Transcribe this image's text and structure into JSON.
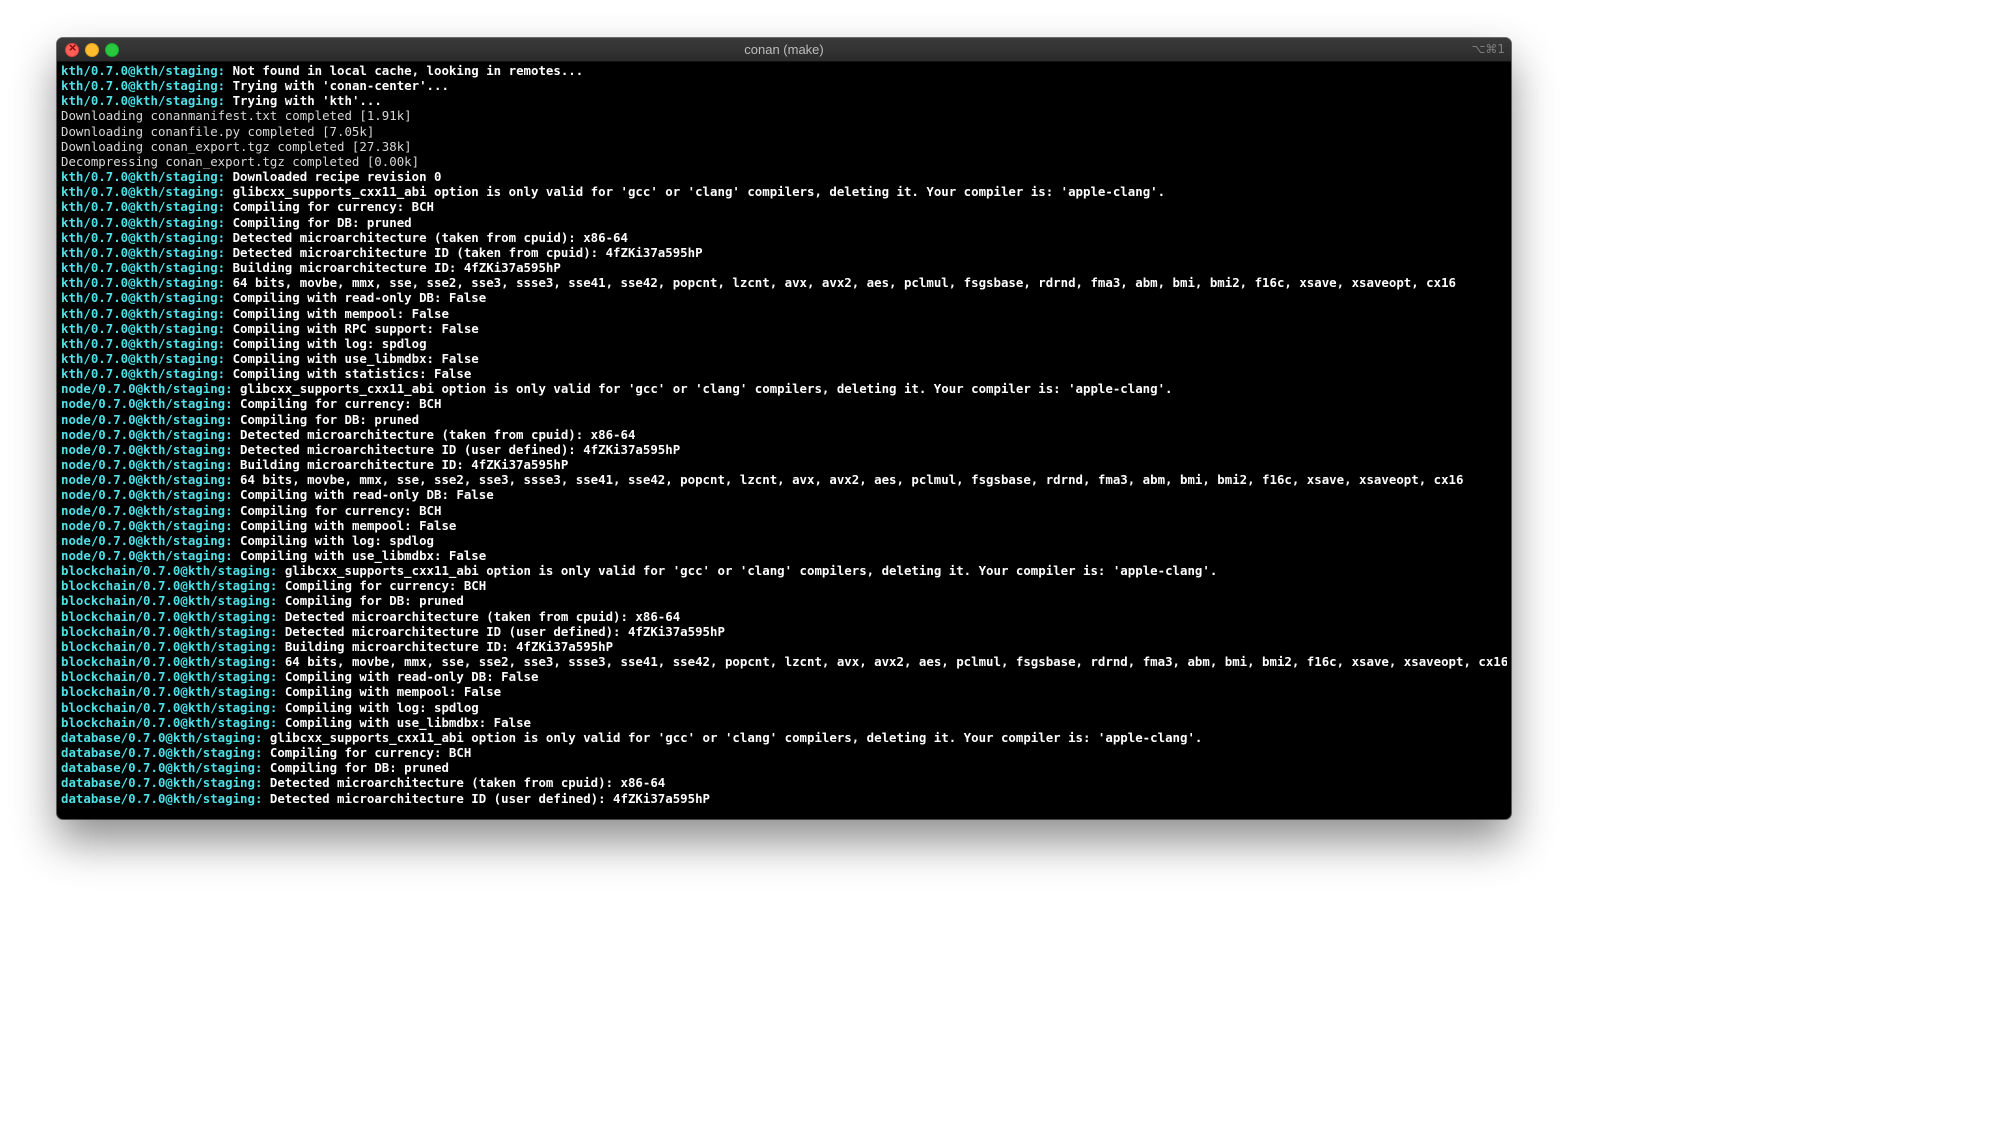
{
  "window": {
    "title": "conan (make)",
    "shortcut": "⌥⌘1"
  },
  "colors": {
    "prefix": "#4fe0e7",
    "text": "#ffffff",
    "background": "#000000"
  },
  "icons": [
    "close-icon",
    "minimize-icon",
    "zoom-icon"
  ],
  "lines": [
    {
      "prefix": "kth/0.7.0@kth/staging:",
      "text": "Not found in local cache, looking in remotes..."
    },
    {
      "prefix": "kth/0.7.0@kth/staging:",
      "text": "Trying with 'conan-center'..."
    },
    {
      "prefix": "kth/0.7.0@kth/staging:",
      "text": "Trying with 'kth'..."
    },
    {
      "prefix": "",
      "text": "Downloading conanmanifest.txt completed [1.91k]"
    },
    {
      "prefix": "",
      "text": "Downloading conanfile.py completed [7.05k]"
    },
    {
      "prefix": "",
      "text": "Downloading conan_export.tgz completed [27.38k]"
    },
    {
      "prefix": "",
      "text": "Decompressing conan_export.tgz completed [0.00k]"
    },
    {
      "prefix": "kth/0.7.0@kth/staging:",
      "text": "Downloaded recipe revision 0"
    },
    {
      "prefix": "kth/0.7.0@kth/staging:",
      "text": "glibcxx_supports_cxx11_abi option is only valid for 'gcc' or 'clang' compilers, deleting it. Your compiler is: 'apple-clang'."
    },
    {
      "prefix": "kth/0.7.0@kth/staging:",
      "text": "Compiling for currency: BCH"
    },
    {
      "prefix": "kth/0.7.0@kth/staging:",
      "text": "Compiling for DB: pruned"
    },
    {
      "prefix": "kth/0.7.0@kth/staging:",
      "text": "Detected microarchitecture (taken from cpuid): x86-64"
    },
    {
      "prefix": "kth/0.7.0@kth/staging:",
      "text": "Detected microarchitecture ID (taken from cpuid): 4fZKi37a595hP"
    },
    {
      "prefix": "kth/0.7.0@kth/staging:",
      "text": "Building microarchitecture ID: 4fZKi37a595hP"
    },
    {
      "prefix": "kth/0.7.0@kth/staging:",
      "text": "64 bits, movbe, mmx, sse, sse2, sse3, ssse3, sse41, sse42, popcnt, lzcnt, avx, avx2, aes, pclmul, fsgsbase, rdrnd, fma3, abm, bmi, bmi2, f16c, xsave, xsaveopt, cx16"
    },
    {
      "prefix": "kth/0.7.0@kth/staging:",
      "text": "Compiling with read-only DB: False"
    },
    {
      "prefix": "kth/0.7.0@kth/staging:",
      "text": "Compiling with mempool: False"
    },
    {
      "prefix": "kth/0.7.0@kth/staging:",
      "text": "Compiling with RPC support: False"
    },
    {
      "prefix": "kth/0.7.0@kth/staging:",
      "text": "Compiling with log: spdlog"
    },
    {
      "prefix": "kth/0.7.0@kth/staging:",
      "text": "Compiling with use_libmdbx: False"
    },
    {
      "prefix": "kth/0.7.0@kth/staging:",
      "text": "Compiling with statistics: False"
    },
    {
      "prefix": "node/0.7.0@kth/staging:",
      "text": "glibcxx_supports_cxx11_abi option is only valid for 'gcc' or 'clang' compilers, deleting it. Your compiler is: 'apple-clang'."
    },
    {
      "prefix": "node/0.7.0@kth/staging:",
      "text": "Compiling for currency: BCH"
    },
    {
      "prefix": "node/0.7.0@kth/staging:",
      "text": "Compiling for DB: pruned"
    },
    {
      "prefix": "node/0.7.0@kth/staging:",
      "text": "Detected microarchitecture (taken from cpuid): x86-64"
    },
    {
      "prefix": "node/0.7.0@kth/staging:",
      "text": "Detected microarchitecture ID (user defined): 4fZKi37a595hP"
    },
    {
      "prefix": "node/0.7.0@kth/staging:",
      "text": "Building microarchitecture ID: 4fZKi37a595hP"
    },
    {
      "prefix": "node/0.7.0@kth/staging:",
      "text": "64 bits, movbe, mmx, sse, sse2, sse3, ssse3, sse41, sse42, popcnt, lzcnt, avx, avx2, aes, pclmul, fsgsbase, rdrnd, fma3, abm, bmi, bmi2, f16c, xsave, xsaveopt, cx16"
    },
    {
      "prefix": "node/0.7.0@kth/staging:",
      "text": "Compiling with read-only DB: False"
    },
    {
      "prefix": "node/0.7.0@kth/staging:",
      "text": "Compiling for currency: BCH"
    },
    {
      "prefix": "node/0.7.0@kth/staging:",
      "text": "Compiling with mempool: False"
    },
    {
      "prefix": "node/0.7.0@kth/staging:",
      "text": "Compiling with log: spdlog"
    },
    {
      "prefix": "node/0.7.0@kth/staging:",
      "text": "Compiling with use_libmdbx: False"
    },
    {
      "prefix": "blockchain/0.7.0@kth/staging:",
      "text": "glibcxx_supports_cxx11_abi option is only valid for 'gcc' or 'clang' compilers, deleting it. Your compiler is: 'apple-clang'."
    },
    {
      "prefix": "blockchain/0.7.0@kth/staging:",
      "text": "Compiling for currency: BCH"
    },
    {
      "prefix": "blockchain/0.7.0@kth/staging:",
      "text": "Compiling for DB: pruned"
    },
    {
      "prefix": "blockchain/0.7.0@kth/staging:",
      "text": "Detected microarchitecture (taken from cpuid): x86-64"
    },
    {
      "prefix": "blockchain/0.7.0@kth/staging:",
      "text": "Detected microarchitecture ID (user defined): 4fZKi37a595hP"
    },
    {
      "prefix": "blockchain/0.7.0@kth/staging:",
      "text": "Building microarchitecture ID: 4fZKi37a595hP"
    },
    {
      "prefix": "blockchain/0.7.0@kth/staging:",
      "text": "64 bits, movbe, mmx, sse, sse2, sse3, ssse3, sse41, sse42, popcnt, lzcnt, avx, avx2, aes, pclmul, fsgsbase, rdrnd, fma3, abm, bmi, bmi2, f16c, xsave, xsaveopt, cx16"
    },
    {
      "prefix": "blockchain/0.7.0@kth/staging:",
      "text": "Compiling with read-only DB: False"
    },
    {
      "prefix": "blockchain/0.7.0@kth/staging:",
      "text": "Compiling with mempool: False"
    },
    {
      "prefix": "blockchain/0.7.0@kth/staging:",
      "text": "Compiling with log: spdlog"
    },
    {
      "prefix": "blockchain/0.7.0@kth/staging:",
      "text": "Compiling with use_libmdbx: False"
    },
    {
      "prefix": "database/0.7.0@kth/staging:",
      "text": "glibcxx_supports_cxx11_abi option is only valid for 'gcc' or 'clang' compilers, deleting it. Your compiler is: 'apple-clang'."
    },
    {
      "prefix": "database/0.7.0@kth/staging:",
      "text": "Compiling for currency: BCH"
    },
    {
      "prefix": "database/0.7.0@kth/staging:",
      "text": "Compiling for DB: pruned"
    },
    {
      "prefix": "database/0.7.0@kth/staging:",
      "text": "Detected microarchitecture (taken from cpuid): x86-64"
    },
    {
      "prefix": "database/0.7.0@kth/staging:",
      "text": "Detected microarchitecture ID (user defined): 4fZKi37a595hP"
    }
  ]
}
